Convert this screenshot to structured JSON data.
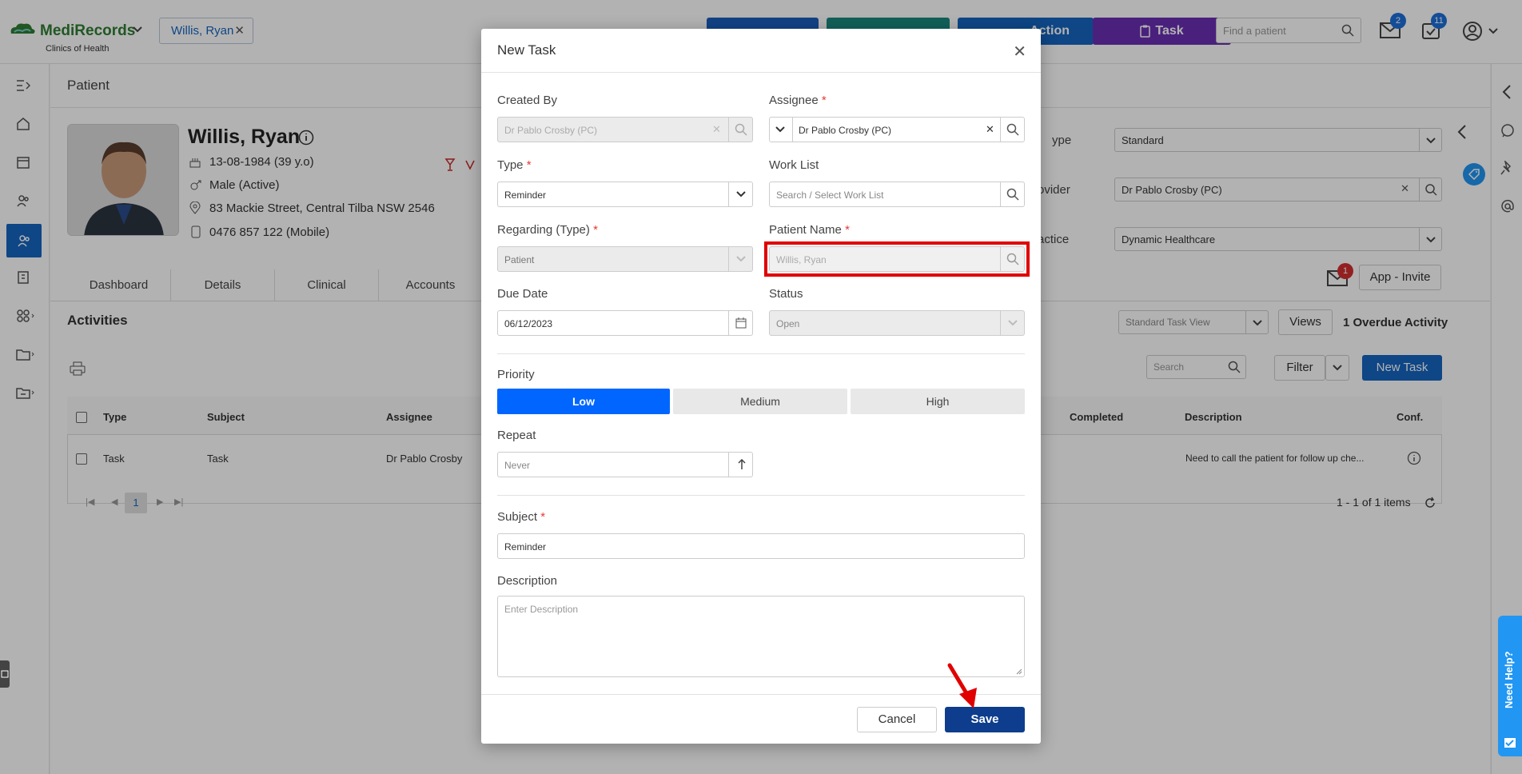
{
  "header": {
    "brand": "MediRecords",
    "brand_sub": "Clinics of Health",
    "patient_chip": "Willis, Ryan",
    "action_btn": "Action",
    "task_btn": "Task",
    "search_placeholder": "Find a patient",
    "mail_count": "2",
    "tasks_count": "11"
  },
  "page": {
    "title": "Patient",
    "patient_name": "Willis, Ryan",
    "dob": "13-08-1984 (39 y.o)",
    "gender": "Male (Active)",
    "address": "83 Mackie Street, Central Tilba NSW 2546",
    "phone": "0476 857 122 (Mobile)",
    "right_labels": [
      "ype",
      "ovider",
      "actice"
    ],
    "type_value": "Standard",
    "provider_value": "Dr Pablo Crosby (PC)",
    "practice_value": "Dynamic Healthcare",
    "invite_count": "1",
    "app_invite": "App - Invite",
    "tabs": [
      "Dashboard",
      "Details",
      "Clinical",
      "Accounts"
    ],
    "activities_title": "Activities",
    "task_view": "Standard Task View",
    "views_btn": "Views",
    "overdue": "1 Overdue Activity",
    "search_placeholder": "Search",
    "filter_btn": "Filter",
    "new_task_btn": "New Task",
    "columns": {
      "type": "Type",
      "subject": "Subject",
      "assignee": "Assignee",
      "completed": "Completed",
      "description": "Description",
      "conf": "Conf."
    },
    "row": {
      "type": "Task",
      "subject": "Task",
      "assignee": "Dr Pablo Crosby",
      "description": "Need to call the patient for follow up che..."
    },
    "page_number": "1",
    "items_info": "1 - 1 of 1 items"
  },
  "modal": {
    "title": "New Task",
    "created_by_label": "Created By",
    "created_by_value": "Dr Pablo Crosby (PC)",
    "assignee_label": "Assignee",
    "assignee_value": "Dr Pablo Crosby (PC)",
    "type_label": "Type",
    "type_value": "Reminder",
    "worklist_label": "Work List",
    "worklist_placeholder": "Search / Select Work List",
    "regarding_label": "Regarding (Type)",
    "regarding_value": "Patient",
    "patient_name_label": "Patient Name",
    "patient_name_value": "Willis, Ryan",
    "due_label": "Due Date",
    "due_value": "06/12/2023",
    "status_label": "Status",
    "status_value": "Open",
    "priority_label": "Priority",
    "priority_options": [
      "Low",
      "Medium",
      "High"
    ],
    "priority_selected": "Low",
    "repeat_label": "Repeat",
    "repeat_value": "Never",
    "subject_label": "Subject",
    "subject_value": "Reminder",
    "description_label": "Description",
    "description_placeholder": "Enter Description",
    "cancel_btn": "Cancel",
    "save_btn": "Save",
    "required_mark": "*"
  },
  "help_label": "Need Help?",
  "colors": {
    "primary": "#0066ff",
    "save": "#0d3d8c",
    "task_btn": "#6a2fb4",
    "highlight": "#e00000"
  }
}
